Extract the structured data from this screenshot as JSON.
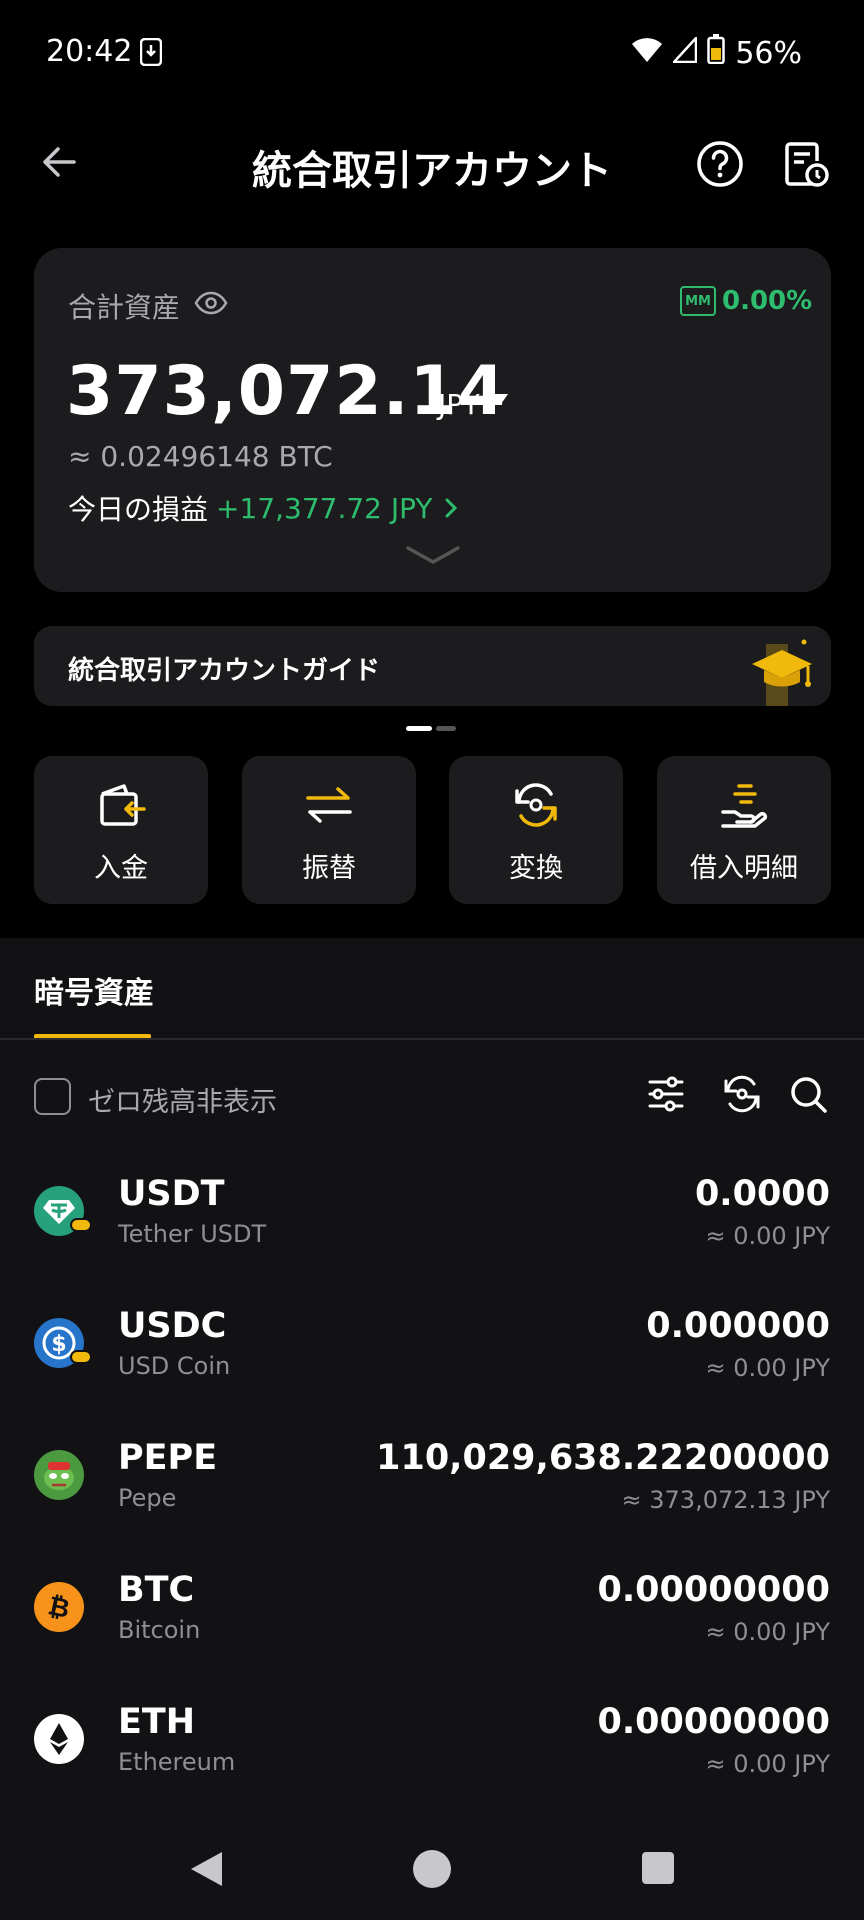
{
  "status_bar": {
    "time": "20:42",
    "battery": "56%"
  },
  "header": {
    "title": "統合取引アカウント"
  },
  "summary": {
    "total_label": "合計資産",
    "mm_badge": "MM",
    "mm_value": "0.00%",
    "balance": "373,072.14",
    "currency": "JPY",
    "btc_equiv": "≈ 0.02496148 BTC",
    "pnl_label": "今日の損益",
    "pnl_value": "+17,377.72 JPY"
  },
  "guide": {
    "text": "統合取引アカウントガイド"
  },
  "actions": [
    {
      "label": "入金",
      "icon": "deposit-icon"
    },
    {
      "label": "振替",
      "icon": "transfer-icon"
    },
    {
      "label": "変換",
      "icon": "convert-icon"
    },
    {
      "label": "借入明細",
      "icon": "loan-icon"
    }
  ],
  "tabs": {
    "crypto": "暗号資産"
  },
  "filter": {
    "hide_zero_label": "ゼロ残高非表示"
  },
  "assets": [
    {
      "symbol": "USDT",
      "name": "Tether USDT",
      "amount": "0.0000",
      "jpy": "≈ 0.00 JPY",
      "color": "#26a17b"
    },
    {
      "symbol": "USDC",
      "name": "USD Coin",
      "amount": "0.000000",
      "jpy": "≈ 0.00 JPY",
      "color": "#2775ca"
    },
    {
      "symbol": "PEPE",
      "name": "Pepe",
      "amount": "110,029,638.22200000",
      "jpy": "≈ 373,072.13 JPY",
      "color": "#4c9a3f"
    },
    {
      "symbol": "BTC",
      "name": "Bitcoin",
      "amount": "0.00000000",
      "jpy": "≈ 0.00 JPY",
      "color": "#f7931a"
    },
    {
      "symbol": "ETH",
      "name": "Ethereum",
      "amount": "0.00000000",
      "jpy": "≈ 0.00 JPY",
      "color": "#ffffff"
    }
  ],
  "colors": {
    "accent": "#f0b90b",
    "positive": "#2ebd6e",
    "card": "#1c1c1e"
  }
}
